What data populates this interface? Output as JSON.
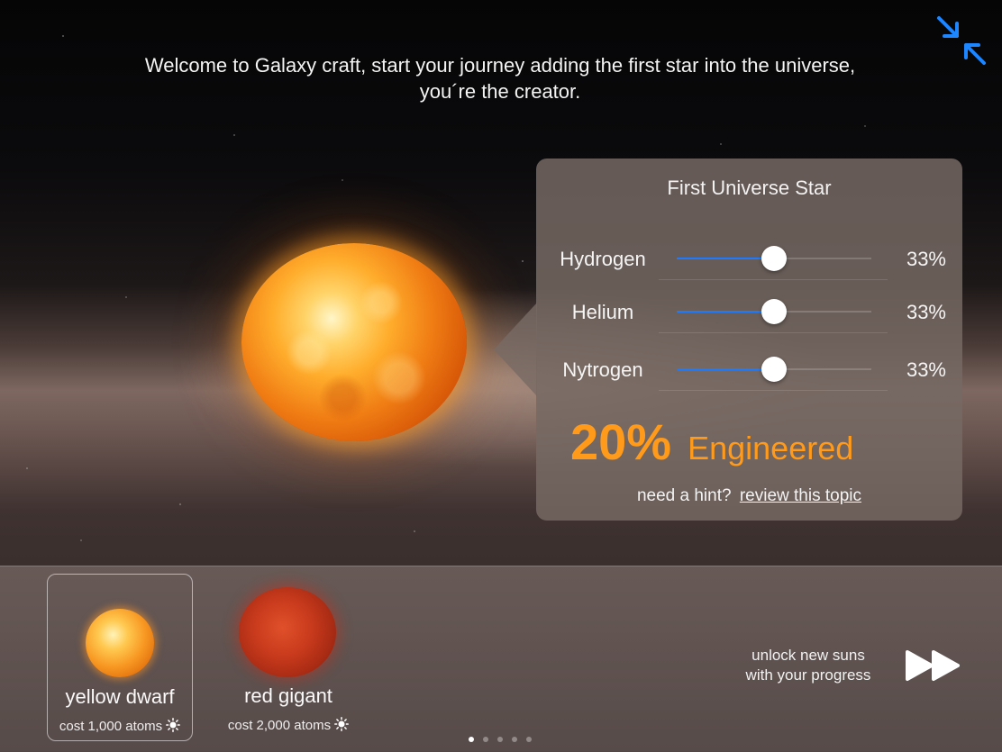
{
  "header": {
    "welcome_text": "Welcome to Galaxy craft, start your journey adding the first star into the universe, you´re the creator."
  },
  "panel": {
    "title": "First Universe Star",
    "elements": [
      {
        "label": "Hydrogen",
        "percent_label": "33%",
        "level": 0.5
      },
      {
        "label": "Helium",
        "percent_label": "33%",
        "level": 0.5
      },
      {
        "label": "Nytrogen",
        "percent_label": "33%",
        "level": 0.5
      }
    ],
    "engineered_value": "20%",
    "engineered_label": "Engineered",
    "hint_prefix": "need a hint?",
    "hint_link": "review this topic"
  },
  "tray": {
    "stars": [
      {
        "name": "yellow dwarf",
        "cost": "cost 1,000 atoms",
        "selected": true
      },
      {
        "name": "red gigant",
        "cost": "cost 2,000 atoms",
        "selected": false
      }
    ],
    "unlock_text_line1": "unlock new suns",
    "unlock_text_line2": "with your progress",
    "page_count": 5,
    "active_page": 1
  },
  "icons": {
    "collapse": "collapse-arrows-icon",
    "fast_forward": "fast-forward-icon",
    "sun": "sun-icon"
  },
  "colors": {
    "accent_blue": "#1e7bff",
    "engineered_orange": "#ff9a1a"
  }
}
